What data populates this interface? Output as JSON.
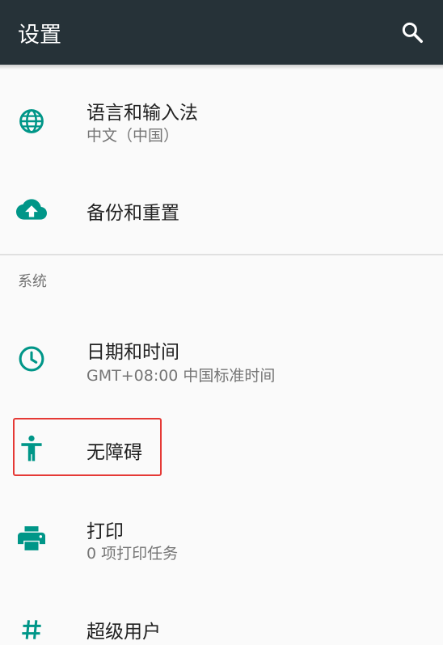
{
  "toolbar": {
    "title": "设置",
    "search_icon": "search-icon"
  },
  "colors": {
    "toolbar_bg": "#263238",
    "accent": "#009688",
    "highlight_border": "#e53935"
  },
  "items": [
    {
      "icon": "globe-icon",
      "title": "语言和输入法",
      "summary": "中文（中国）"
    },
    {
      "icon": "cloud-upload-icon",
      "title": "备份和重置"
    }
  ],
  "category": "系统",
  "system_items": [
    {
      "icon": "clock-icon",
      "title": "日期和时间",
      "summary": "GMT+08:00 中国标准时间"
    },
    {
      "icon": "accessibility-icon",
      "title": "无障碍",
      "highlighted": true
    },
    {
      "icon": "printer-icon",
      "title": "打印",
      "summary": "0 项打印任务"
    },
    {
      "icon": "hash-icon",
      "title": "超级用户"
    }
  ]
}
